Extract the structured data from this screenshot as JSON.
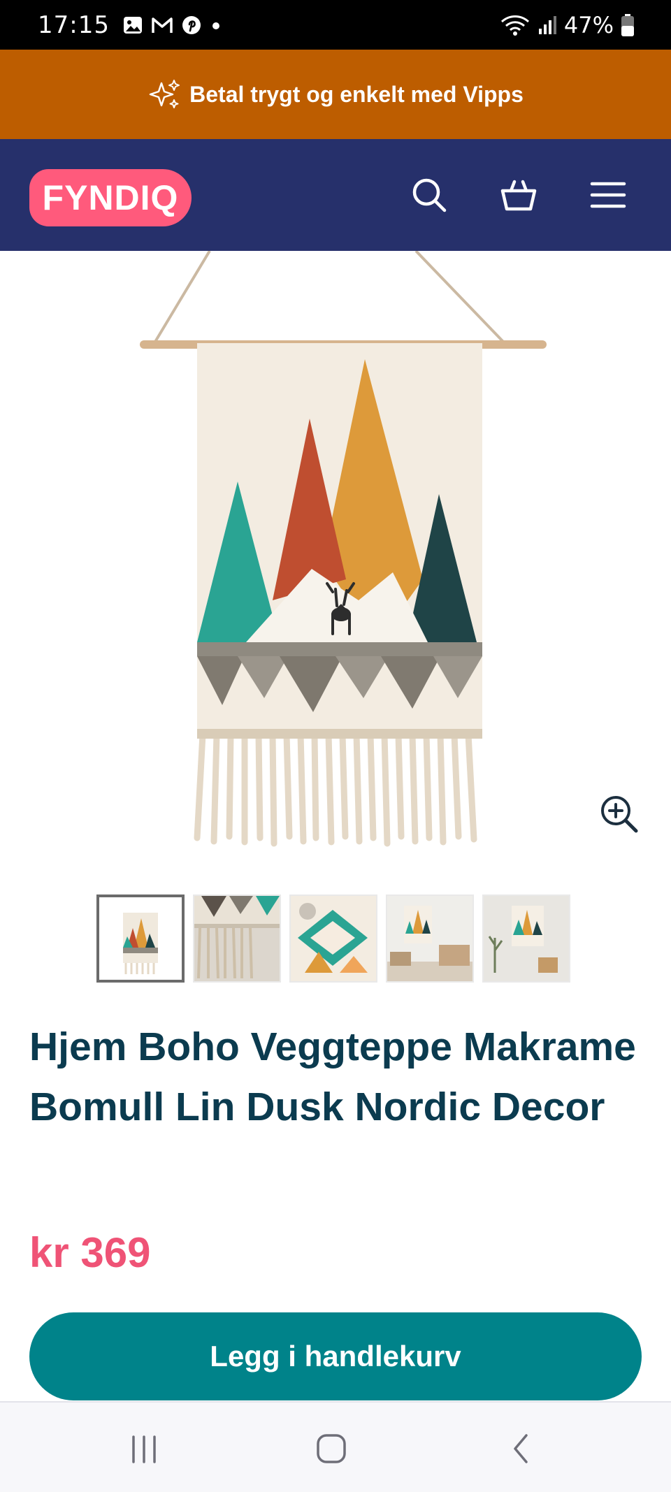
{
  "status_bar": {
    "time": "17:15",
    "battery": "47%",
    "icons": [
      "gallery-icon",
      "gmail-icon",
      "pinterest-icon",
      "dot-icon",
      "wifi-icon",
      "signal-icon",
      "battery-icon"
    ]
  },
  "promo_banner": {
    "text": "Betal trygt og enkelt med Vipps",
    "icon": "sparkle-icon",
    "color": "#bd5d00"
  },
  "header": {
    "logo_text": "FYNDIQ",
    "logo_color": "#ff5a7c",
    "background": "#26306b",
    "icons": [
      "search-icon",
      "basket-icon",
      "menu-icon"
    ]
  },
  "product": {
    "title": "Hjem Boho Veggteppe Makrame Bomull Lin Dusk Nordic Decor",
    "price": "kr 369",
    "price_color": "#ef5376",
    "add_to_cart_label": "Legg i handlekurv",
    "cta_color": "#00838a",
    "thumbnails_count": 5,
    "active_thumbnail": 1
  },
  "nav_bar": {
    "icons": [
      "recent-apps-icon",
      "home-icon",
      "back-icon"
    ]
  }
}
